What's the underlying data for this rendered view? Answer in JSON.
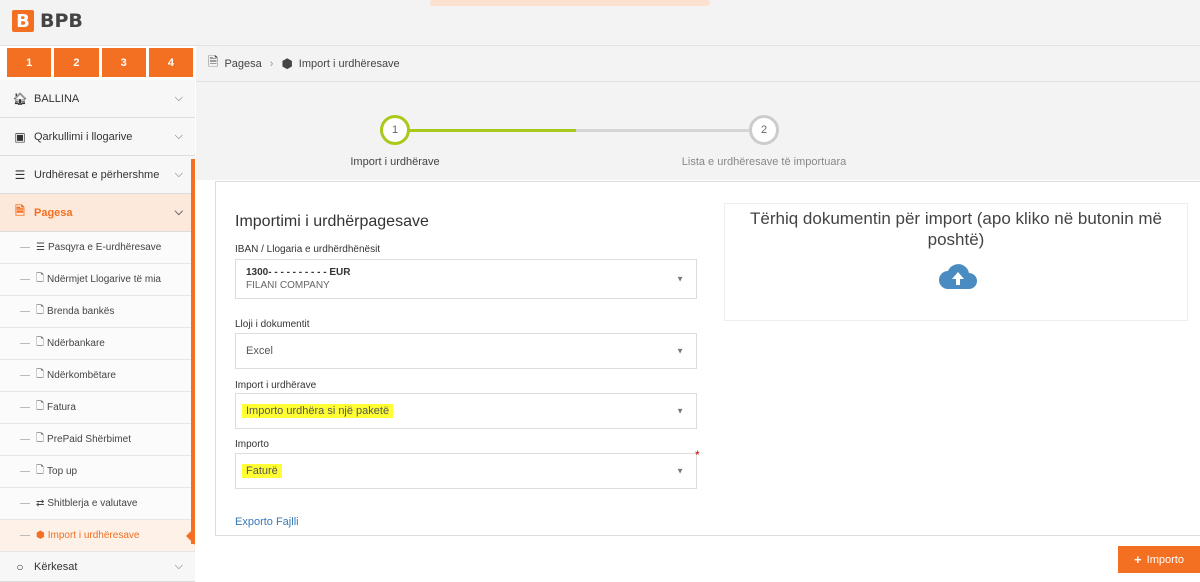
{
  "app": {
    "brand": "BPB",
    "logo_glyph": "B"
  },
  "steps_tabs": [
    "1",
    "2",
    "3",
    "4"
  ],
  "sidebar": {
    "top": [
      {
        "label": "BALLINA",
        "icon": "home-icon"
      },
      {
        "label": "Qarkullimi i llogarive",
        "icon": "money-icon"
      },
      {
        "label": "Urdhëresat e përhershme",
        "icon": "list-icon"
      },
      {
        "label": "Pagesa",
        "icon": "document-icon"
      }
    ],
    "sub": [
      {
        "label": "Pasqyra e E-urdhëresave",
        "icon": "☰"
      },
      {
        "label": "Ndërmjet Llogarive të mia",
        "icon": "🗋"
      },
      {
        "label": "Brenda bankës",
        "icon": "🗋"
      },
      {
        "label": "Ndërbankare",
        "icon": "🗋"
      },
      {
        "label": "Ndërkombëtare",
        "icon": "🗋"
      },
      {
        "label": "Fatura",
        "icon": "🗋"
      },
      {
        "label": "PrePaid Shërbimet",
        "icon": "🗋"
      },
      {
        "label": "Top up",
        "icon": "🗋"
      },
      {
        "label": "Shitblerja e valutave",
        "icon": "⇄"
      },
      {
        "label": "Import i urdhëresave",
        "icon": "⬢"
      }
    ],
    "bottom": {
      "label": "Kërkesat",
      "icon": "circle-icon"
    }
  },
  "breadcrumb": {
    "root": "Pagesa",
    "current": "Import i urdhëresave"
  },
  "wizard": {
    "step1": {
      "num": "1",
      "label": "Import i urdhërave"
    },
    "step2": {
      "num": "2",
      "label": "Lista e urdhëresave të importuara"
    },
    "active_color": "#a8c81a"
  },
  "form": {
    "title": "Importimi i urdhërpagesave",
    "iban_label": "IBAN / Llogaria e urdhërdhënësit",
    "iban_value": "1300-  -  -  -  -  -  -   -  -  -  EUR",
    "iban_name": "FILANI COMPANY",
    "doctype_label": "Lloji i dokumentit",
    "doctype_value": "Excel",
    "import_label": "Import i urdhërave",
    "import_value": "Importo urdhëra si një paketë",
    "importo_label": "Importo",
    "importo_value": "Faturë",
    "required_mark": "*",
    "export_link": "Exporto Fajlli"
  },
  "dropzone": {
    "text": "Tërhiq dokumentin për import (apo kliko në butonin më poshtë)",
    "icon": "cloud-upload-icon",
    "color": "#4a8bc2"
  },
  "actions": {
    "importo": "Importo",
    "plus": "+"
  }
}
